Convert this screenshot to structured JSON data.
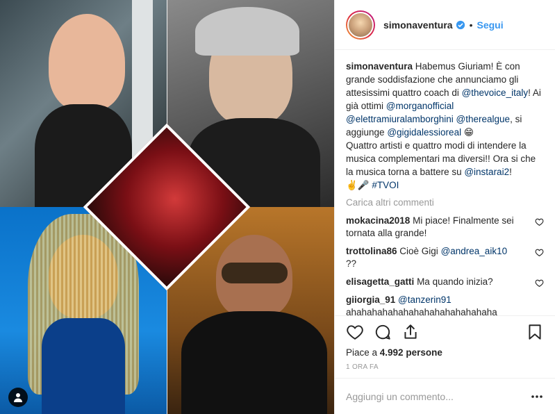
{
  "header": {
    "username": "simonaventura",
    "dot": "•",
    "follow_label": "Segui"
  },
  "caption": {
    "username": "simonaventura",
    "part1": "Habemus Giuriam! È con grande soddisfazione che annunciamo gli attesissimi quattro coach di ",
    "tag1": "@thevoice_italy",
    "part2": "! Ai già ottimi ",
    "tag2": "@morganofficial",
    "tag3": "@elettramiuralamborghini",
    "tag4": "@therealgue",
    "part3": ", si aggiunge ",
    "tag5": "@gigidalessioreal",
    "emoji1": "😁",
    "part4": "Quattro artisti e quattro modi di intendere la musica complementari ma diversi!! Ora si che la musica torna a battere su ",
    "tag6": "@instarai2",
    "part5": "!",
    "emoji2": "✌️🎤",
    "tag7": "#TVOI"
  },
  "load_more": "Carica altri commenti",
  "comments": [
    {
      "user": "mokacina2018",
      "text": "Mi piace! Finalmente sei tornata alla grande!"
    },
    {
      "user": "trottolina86",
      "text_before": "Cioè Gigi ",
      "tag": "@andrea_aik10",
      "text_after": "??"
    },
    {
      "user": "elisagetta_gatti",
      "text": "Ma quando inizia?"
    },
    {
      "user": "giiorgia_91",
      "tag": "@tanzerin91",
      "text": "ahahahahahahahahahahahahahaha"
    }
  ],
  "likes": {
    "prefix": "Piace a ",
    "count": "4.992",
    "suffix": " persone"
  },
  "timestamp": "1 ORA FA",
  "add_comment": {
    "placeholder": "Aggiungi un commento..."
  },
  "icons": {
    "like": "heart-icon",
    "comment": "comment-icon",
    "share": "share-icon",
    "save": "bookmark-icon",
    "more": "more-icon",
    "verified": "verified-icon",
    "user_tag": "user-icon"
  },
  "colors": {
    "link": "#3897f0",
    "tag": "#003569",
    "muted": "#999999",
    "text": "#262626"
  }
}
